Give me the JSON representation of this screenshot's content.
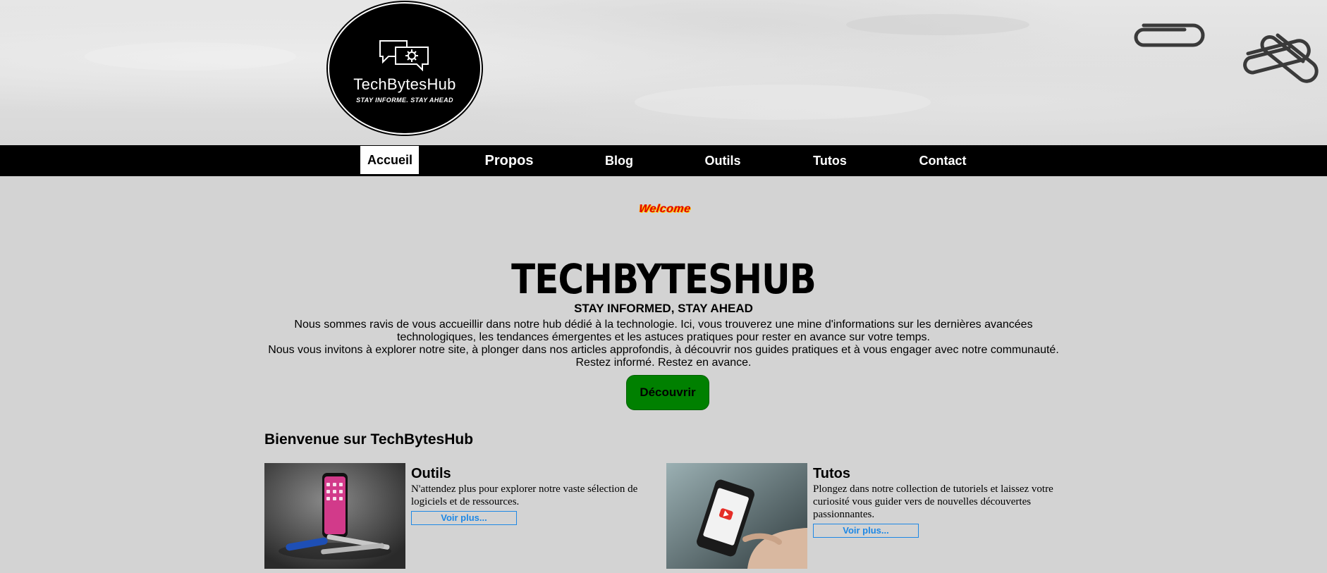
{
  "logo": {
    "name": "TechBytesHub",
    "tagline": "STAY INFORME. STAY AHEAD"
  },
  "nav": {
    "items": [
      {
        "label": "Accueil"
      },
      {
        "label": "Propos"
      },
      {
        "label": "Blog"
      },
      {
        "label": "Outils"
      },
      {
        "label": "Tutos"
      },
      {
        "label": "Contact"
      }
    ]
  },
  "hero": {
    "welcome": "Welcome",
    "title": "TECHBYTESHUB",
    "subtitle": "STAY INFORMED, STAY AHEAD",
    "paragraph_1": "Nous sommes ravis de vous accueillir dans notre hub dédié à la technologie. Ici, vous trouverez une mine d'informations sur les dernières avancées technologiques, les tendances émergentes et les astuces pratiques pour rester en avance sur votre temps.",
    "paragraph_2": "Nous vous invitons à explorer notre site, à plonger dans nos articles approfondis, à découvrir nos guides pratiques et à vous engager avec notre communauté. Restez informé. Restez en avance.",
    "cta_label": "Découvrir"
  },
  "section": {
    "title": "Bienvenue sur TechBytesHub"
  },
  "cards": [
    {
      "title": "Outils",
      "text": "N'attendez plus pour explorer notre vaste sélection de logiciels et de ressources.",
      "button": "Voir plus..."
    },
    {
      "title": "Tutos",
      "text": "Plongez dans notre collection de tutoriels et laissez votre curiosité vous guider vers de nouvelles découvertes passionnantes.",
      "button": "Voir plus..."
    }
  ],
  "colors": {
    "nav_bg": "#000000",
    "page_bg": "#d3d3d3",
    "cta_bg": "#008000",
    "link_blue": "#1e88e5"
  }
}
